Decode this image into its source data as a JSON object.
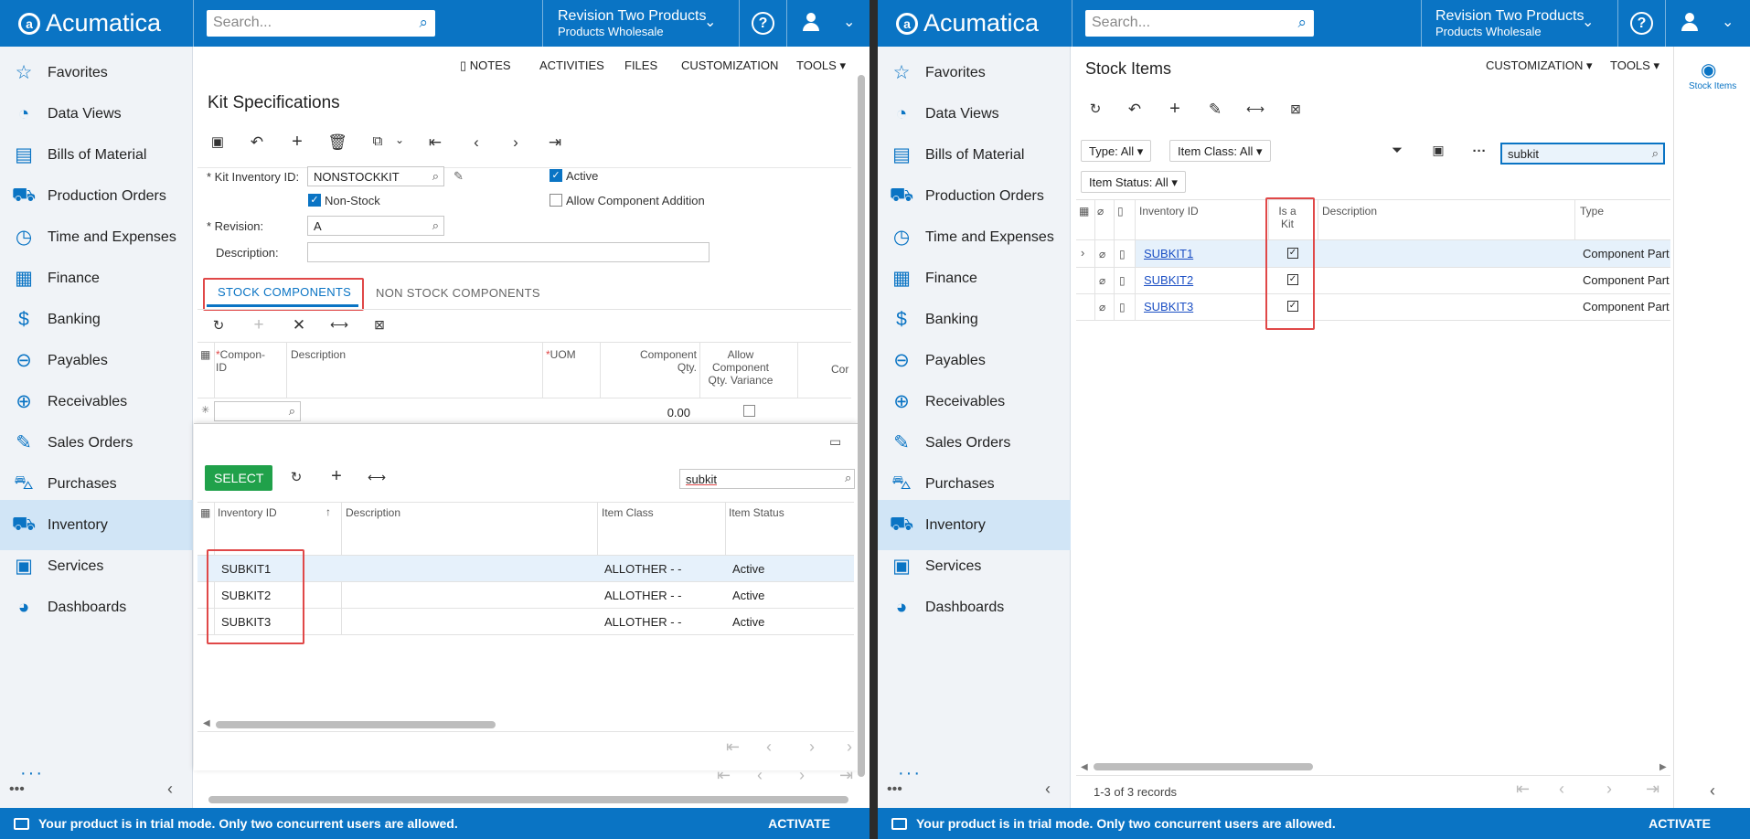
{
  "header": {
    "logo_text": "Acumatica",
    "search_placeholder": "Search...",
    "company_line1": "Revision Two Products",
    "company_line2": "Products Wholesale",
    "help_glyph": "?",
    "brand_color": "#0a74c4"
  },
  "sidebar": {
    "items": [
      {
        "label": "Favorites",
        "icon": "star-icon",
        "glyph": "☆"
      },
      {
        "label": "Data Views",
        "icon": "pie-chart-icon",
        "glyph": "◔"
      },
      {
        "label": "Bills of Material",
        "icon": "document-icon",
        "glyph": "▤"
      },
      {
        "label": "Production Orders",
        "icon": "truck-icon",
        "glyph": "⛟"
      },
      {
        "label": "Time and Expenses",
        "icon": "stopwatch-icon",
        "glyph": "◷"
      },
      {
        "label": "Finance",
        "icon": "calculator-icon",
        "glyph": "▦"
      },
      {
        "label": "Banking",
        "icon": "dollar-icon",
        "glyph": "$"
      },
      {
        "label": "Payables",
        "icon": "minus-circle-icon",
        "glyph": "⊖"
      },
      {
        "label": "Receivables",
        "icon": "plus-circle-icon",
        "glyph": "⊕"
      },
      {
        "label": "Sales Orders",
        "icon": "edit-icon",
        "glyph": "✎"
      },
      {
        "label": "Purchases",
        "icon": "cart-icon",
        "glyph": "⛍"
      },
      {
        "label": "Inventory",
        "icon": "truck-icon",
        "glyph": "⛟"
      },
      {
        "label": "Services",
        "icon": "briefcase-icon",
        "glyph": "▣"
      },
      {
        "label": "Dashboards",
        "icon": "dashboard-icon",
        "glyph": "◕"
      }
    ],
    "active_index": 11,
    "more_glyph": "···",
    "collapse_glyph": "‹"
  },
  "status_bar": {
    "message": "Your product is in trial mode. Only two concurrent users are allowed.",
    "activate_label": "ACTIVATE"
  },
  "left": {
    "top_links": [
      "NOTES",
      "ACTIVITIES",
      "FILES",
      "CUSTOMIZATION",
      "TOOLS"
    ],
    "title": "Kit Specifications",
    "form": {
      "kit_inventory_id_label": "Kit Inventory ID:",
      "kit_inventory_id_value": "NONSTOCKKIT",
      "non_stock_label": "Non-Stock",
      "revision_label": "Revision:",
      "revision_value": "A",
      "description_label": "Description:",
      "description_value": "",
      "active_label": "Active",
      "allow_component_addition_label": "Allow Component Addition"
    },
    "tabs": [
      "STOCK COMPONENTS",
      "NON STOCK COMPONENTS"
    ],
    "components_grid": {
      "col_component_id": "Compon- ID",
      "col_description": "Description",
      "col_uom": "UOM",
      "col_component_qty": "Component Qty.",
      "col_allow_variance": "Allow Component Qty. Variance",
      "col_truncated": "Cor",
      "new_row_qty": "0.00"
    },
    "lookup": {
      "select_label": "SELECT",
      "search_value": "subkit",
      "columns": [
        "Inventory ID",
        "Description",
        "Item Class",
        "Item Status"
      ],
      "rows": [
        {
          "id": "SUBKIT1",
          "description": "",
          "item_class": "ALLOTHER - -",
          "status": "Active"
        },
        {
          "id": "SUBKIT2",
          "description": "",
          "item_class": "ALLOTHER - -",
          "status": "Active"
        },
        {
          "id": "SUBKIT3",
          "description": "",
          "item_class": "ALLOTHER - -",
          "status": "Active"
        }
      ]
    }
  },
  "right": {
    "top_links": [
      "CUSTOMIZATION",
      "TOOLS"
    ],
    "title": "Stock Items",
    "right_panel_label": "Stock Items",
    "filters": {
      "type": "Type: All",
      "item_class": "Item Class: All",
      "item_status": "Item Status: All",
      "search_value": "subkit"
    },
    "columns": [
      "Inventory ID",
      "Is a Kit",
      "Description",
      "Type"
    ],
    "rows": [
      {
        "id": "SUBKIT1",
        "is_kit": true,
        "description": "",
        "type": "Component Part"
      },
      {
        "id": "SUBKIT2",
        "is_kit": true,
        "description": "",
        "type": "Component Part"
      },
      {
        "id": "SUBKIT3",
        "is_kit": true,
        "description": "",
        "type": "Component Part"
      }
    ],
    "records_label": "1-3 of 3 records"
  }
}
